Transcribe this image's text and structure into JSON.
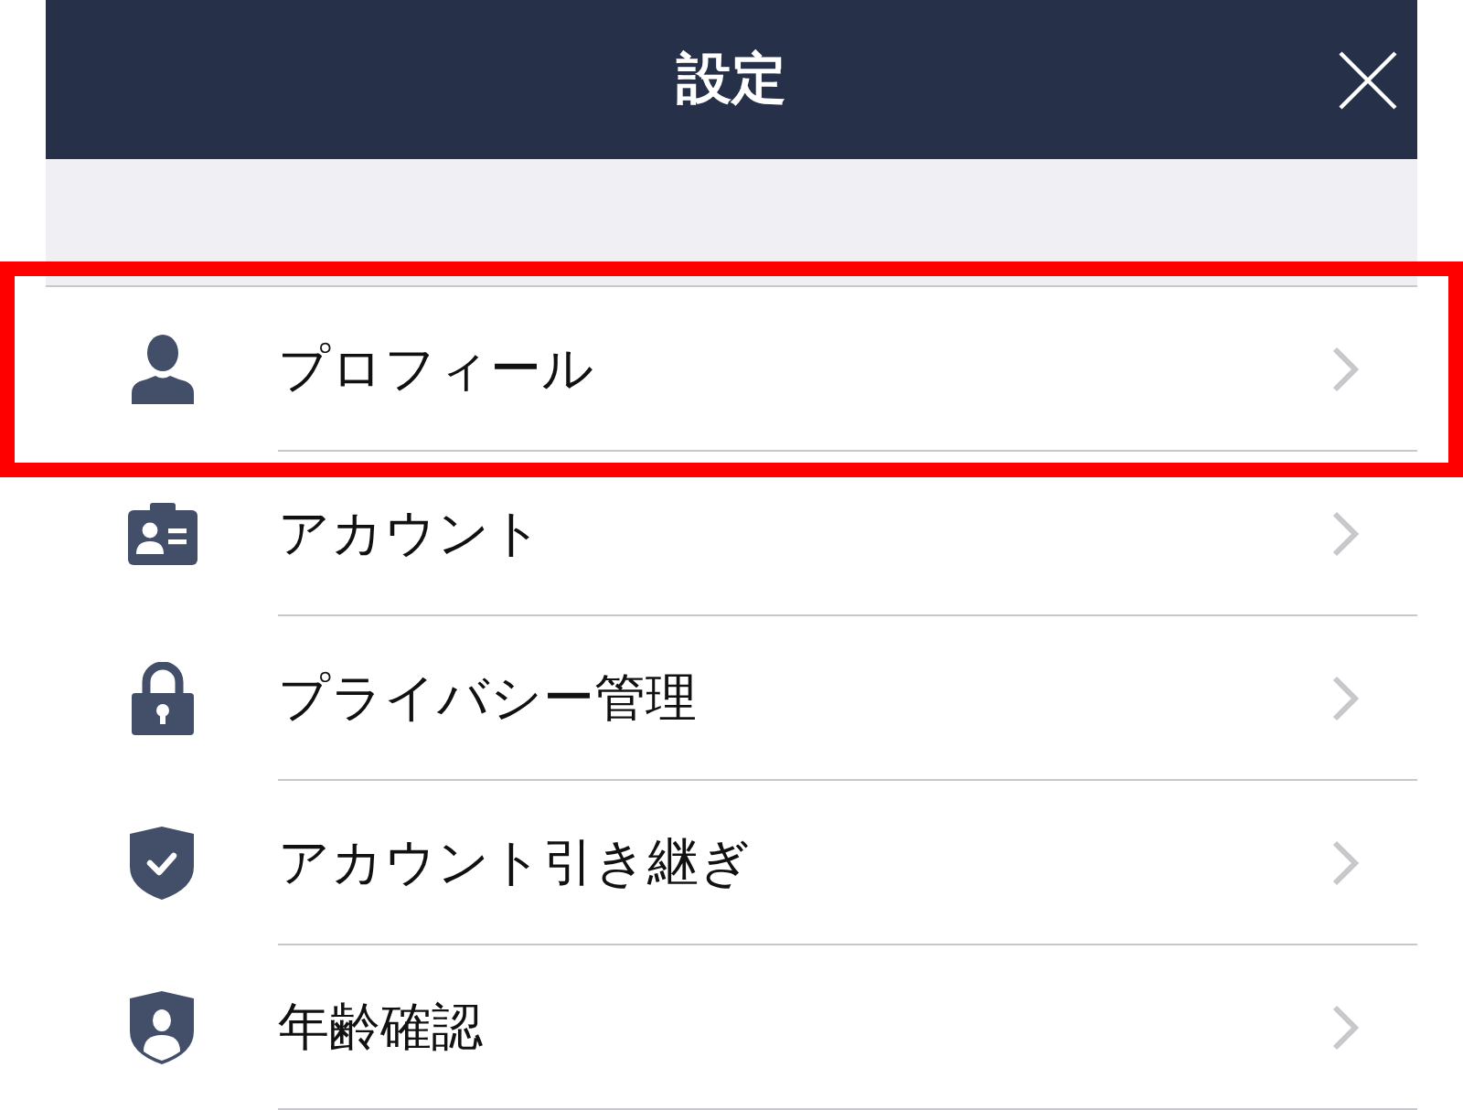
{
  "header": {
    "title": "設定"
  },
  "items": [
    {
      "kind": "person",
      "label": "プロフィール",
      "highlighted": true
    },
    {
      "kind": "id-card",
      "label": "アカウント",
      "highlighted": false
    },
    {
      "kind": "lock",
      "label": "プライバシー管理",
      "highlighted": false
    },
    {
      "kind": "shield-check",
      "label": "アカウント引き継ぎ",
      "highlighted": false
    },
    {
      "kind": "shield-person",
      "label": "年齢確認",
      "highlighted": false
    }
  ]
}
